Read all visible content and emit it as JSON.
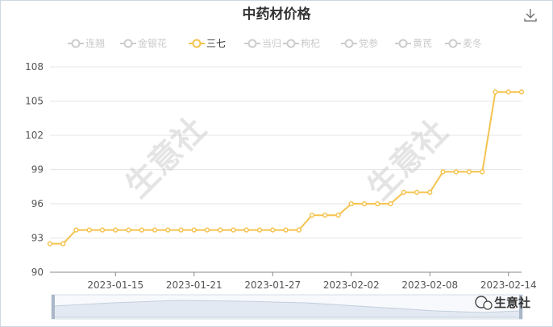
{
  "chart_data": {
    "type": "line",
    "title": "中药材价格",
    "legend": {
      "placement": "top-center",
      "items": [
        {
          "name": "连翘",
          "active": false
        },
        {
          "name": "金银花",
          "active": false
        },
        {
          "name": "三七",
          "active": true
        },
        {
          "name": "当归",
          "active": false
        },
        {
          "name": "枸杞",
          "active": false
        },
        {
          "name": "党参",
          "active": false
        },
        {
          "name": "黄芪",
          "active": false
        },
        {
          "name": "麦冬",
          "active": false
        }
      ]
    },
    "x_tick_labels": [
      "2023-01-15",
      "2023-01-21",
      "2023-01-27",
      "2023-02-02",
      "2023-02-08",
      "2023-02-14"
    ],
    "y_tick_labels": [
      "90",
      "93",
      "96",
      "99",
      "102",
      "105",
      "108"
    ],
    "ylim": [
      90,
      108
    ],
    "grid": true,
    "x": [
      "2023-01-10",
      "2023-01-11",
      "2023-01-12",
      "2023-01-13",
      "2023-01-14",
      "2023-01-15",
      "2023-01-16",
      "2023-01-17",
      "2023-01-18",
      "2023-01-19",
      "2023-01-20",
      "2023-01-21",
      "2023-01-22",
      "2023-01-23",
      "2023-01-24",
      "2023-01-25",
      "2023-01-26",
      "2023-01-27",
      "2023-01-28",
      "2023-01-29",
      "2023-01-30",
      "2023-01-31",
      "2023-02-01",
      "2023-02-02",
      "2023-02-03",
      "2023-02-04",
      "2023-02-05",
      "2023-02-06",
      "2023-02-07",
      "2023-02-08",
      "2023-02-09",
      "2023-02-10",
      "2023-02-11",
      "2023-02-12",
      "2023-02-13",
      "2023-02-14",
      "2023-02-15"
    ],
    "series": [
      {
        "name": "三七",
        "color": "#f5c34f",
        "values": [
          92.5,
          92.5,
          93.7,
          93.7,
          93.7,
          93.7,
          93.7,
          93.7,
          93.7,
          93.7,
          93.7,
          93.7,
          93.7,
          93.7,
          93.7,
          93.7,
          93.7,
          93.7,
          93.7,
          93.7,
          95.0,
          95.0,
          95.0,
          96.0,
          96.0,
          96.0,
          96.0,
          97.0,
          97.0,
          97.0,
          98.8,
          98.8,
          98.8,
          98.8,
          105.8,
          105.8,
          105.8
        ]
      }
    ],
    "watermark": "生意社",
    "brand": "生意社"
  }
}
